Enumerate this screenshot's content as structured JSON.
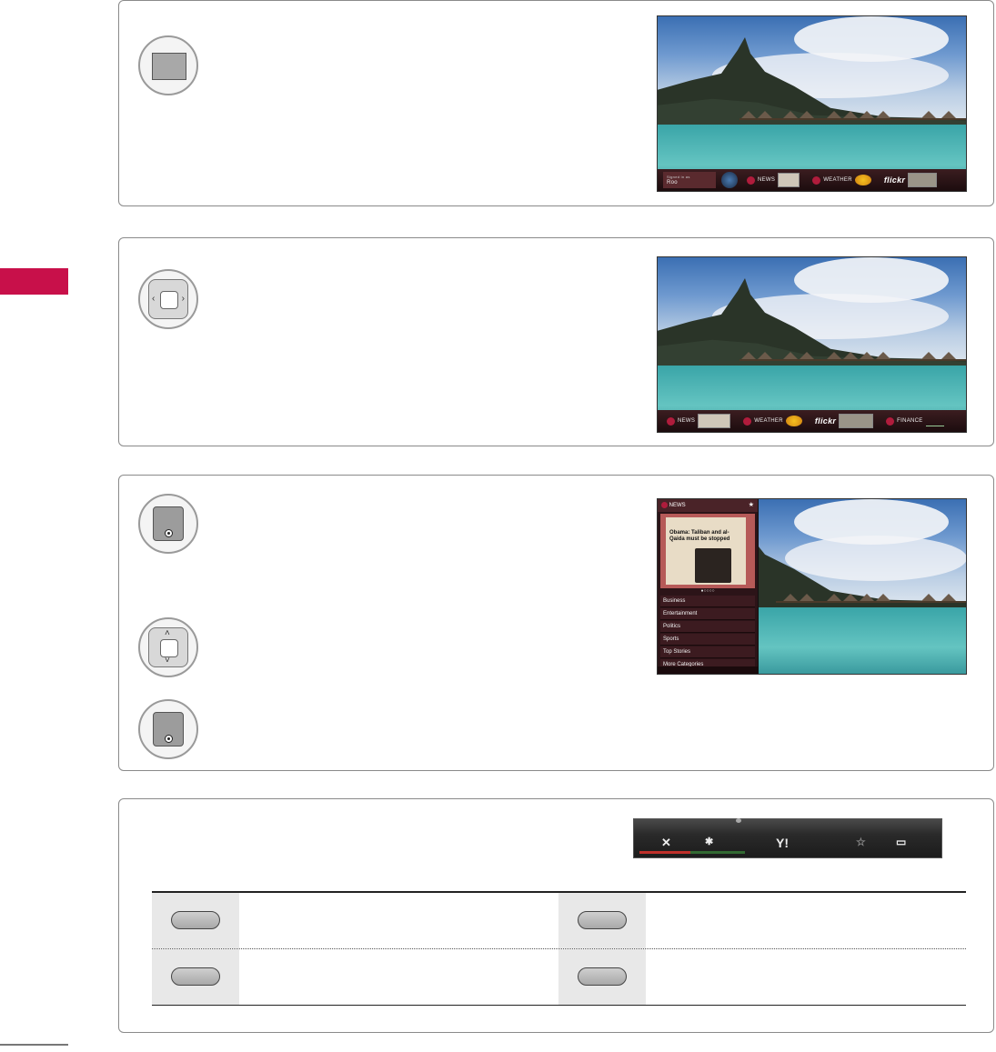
{
  "page": {
    "side_tab_color": "#c8104a"
  },
  "step1": {
    "button_icon": "rectangle-key-icon",
    "screenshot": {
      "bar_items": [
        {
          "kind": "text",
          "line1": "Signed in as",
          "line2": "Roo"
        },
        {
          "kind": "yahoo",
          "label": "NEWS"
        },
        {
          "kind": "yahoo",
          "label": "WEATHER"
        },
        {
          "kind": "brand",
          "label": "flickr"
        }
      ]
    }
  },
  "step2": {
    "button_icon": "dpad-left-right-icon",
    "screenshot": {
      "bar_items": [
        {
          "kind": "yahoo",
          "label": "NEWS"
        },
        {
          "kind": "yahoo",
          "label": "WEATHER"
        },
        {
          "kind": "brand",
          "label": "flickr"
        },
        {
          "kind": "yahoo",
          "label": "FINANCE"
        }
      ]
    }
  },
  "step3": {
    "buttons": [
      "ok-button-icon",
      "dpad-up-down-icon",
      "ok-button-icon"
    ],
    "screenshot": {
      "panel_title": "NEWS",
      "headline": "Obama: Taliban and al-Qaida must be stopped",
      "categories": [
        "Business",
        "Entertainment",
        "Politics",
        "Sports",
        "Top Stories",
        "More Categories"
      ]
    }
  },
  "step4": {
    "toolbar_icons": [
      "close-icon",
      "settings-icon",
      "yahoo-icon",
      "star-icon",
      "window-icon"
    ],
    "color_bar": [
      "#c0302a",
      "#3a8a3a",
      "#c8a020",
      "#2a5aa8"
    ],
    "key_rows": 2,
    "key_cols": 2
  }
}
